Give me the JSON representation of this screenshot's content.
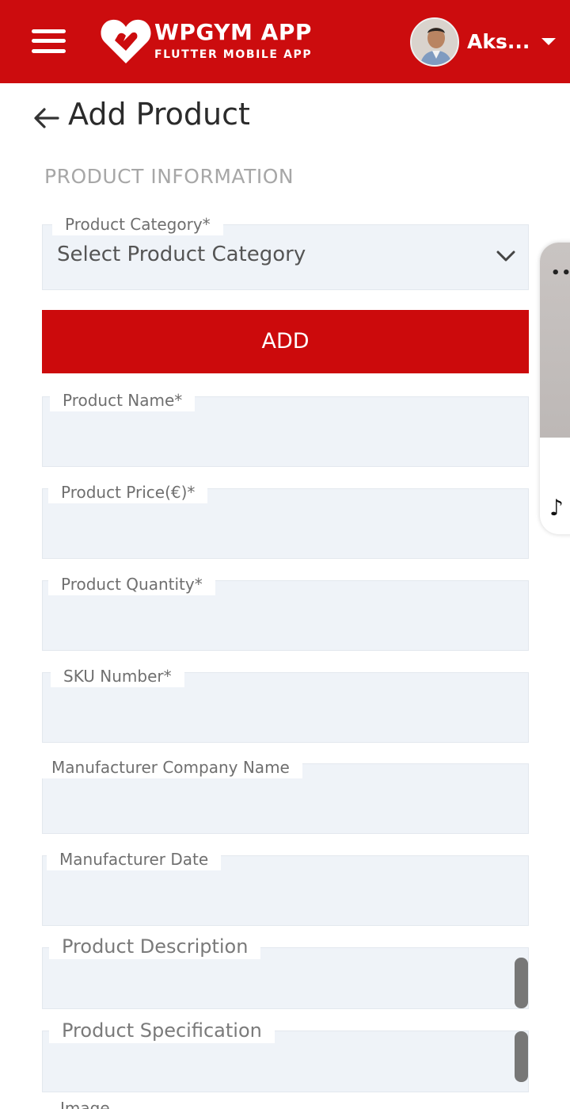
{
  "header": {
    "brand_title": "WPGYM APP",
    "brand_subtitle": "FLUTTER MOBILE APP",
    "username": "Aks...",
    "accent_color": "#cc0c0e"
  },
  "page": {
    "title": "Add Product",
    "section_title": "PRODUCT INFORMATION"
  },
  "form": {
    "category": {
      "label": "Product Category*",
      "value": "Select Product Category"
    },
    "add_button": "ADD",
    "product_name": {
      "label": "Product Name*",
      "value": ""
    },
    "product_price": {
      "label": "Product Price(€)*",
      "value": ""
    },
    "product_quantity": {
      "label": "Product Quantity*",
      "value": ""
    },
    "sku_number": {
      "label": "SKU Number*",
      "value": ""
    },
    "manufacturer_company": {
      "label": "Manufacturer Company Name",
      "value": ""
    },
    "manufacturer_date": {
      "label": "Manufacturer Date",
      "value": ""
    },
    "product_description": {
      "label": "Product Description",
      "value": ""
    },
    "product_specification": {
      "label": "Product Specification",
      "value": ""
    },
    "image_label": "Image"
  },
  "icons": {
    "menu": "hamburger-icon",
    "logo": "heart-logo-icon",
    "dropdown": "chevron-down-icon",
    "back": "arrow-left-icon",
    "music": "music-note-icon"
  }
}
